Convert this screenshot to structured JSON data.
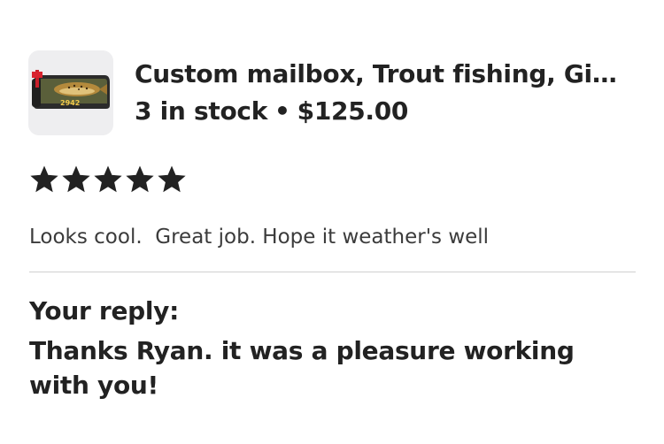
{
  "listing": {
    "title": "Custom mailbox, Trout fishing, Gi…",
    "stock": "3 in stock",
    "separator": "•",
    "price": "$125.00",
    "thumbnail_number": "2942"
  },
  "review": {
    "rating": 5,
    "max_rating": 5,
    "star_color": "#222222",
    "text": "Looks cool.  Great job. Hope it weather's well"
  },
  "reply": {
    "label": "Your reply:",
    "text": "Thanks Ryan. it was a pleasure working with you!"
  }
}
